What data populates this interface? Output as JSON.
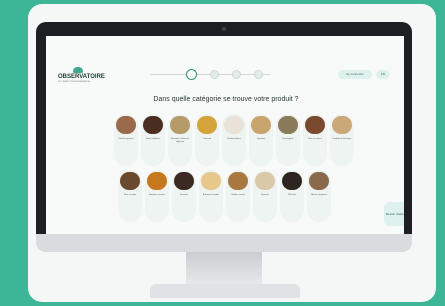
{
  "logo": {
    "name": "OBSERVATOIRE",
    "tagline": "DE L'IMPACT ENVIRONNEMENTAL"
  },
  "progress": {
    "current_step": 1,
    "total_steps": 5
  },
  "nav": {
    "account_label": "Se connecter",
    "language": "FR"
  },
  "question": "Dans quelle catégorie se trouve votre produit ?",
  "categories_row1": [
    {
      "label": "Viandes grasses",
      "color": "#9a6a4a"
    },
    {
      "label": "Boeuf et gibiers",
      "color": "#4a2e22"
    },
    {
      "label": "Boissons, chaleur et végétaux",
      "color": "#b59b6a"
    },
    {
      "label": "Crèmerie",
      "color": "#d4a43a"
    },
    {
      "label": "Produits laitiers",
      "color": "#e8e2d8"
    },
    {
      "label": "Légumes",
      "color": "#c9a46c"
    },
    {
      "label": "Boulangerie",
      "color": "#8a7a5a"
    },
    {
      "label": "Plats et sauces",
      "color": "#7a4a2e"
    },
    {
      "label": "Produits de Fromage",
      "color": "#caa877"
    }
  ],
  "categories_row2": [
    {
      "label": "Plats et repas",
      "color": "#6a4a2e"
    },
    {
      "label": "Boissons sucrées",
      "color": "#c7781f"
    },
    {
      "label": "Desserts",
      "color": "#3a2a22"
    },
    {
      "label": "Boissons chaudes",
      "color": "#e8c88a"
    },
    {
      "label": "Goûters sucrés",
      "color": "#a9783e"
    },
    {
      "label": "Épicerie",
      "color": "#d9c9a8"
    },
    {
      "label": "Plats bio",
      "color": "#2e2420"
    },
    {
      "label": "Autres catégories",
      "color": "#8a6a4a"
    }
  ],
  "side_tab": "Besoin d'aide",
  "colors": {
    "accent": "#3ea98f",
    "background": "#3cb697"
  }
}
